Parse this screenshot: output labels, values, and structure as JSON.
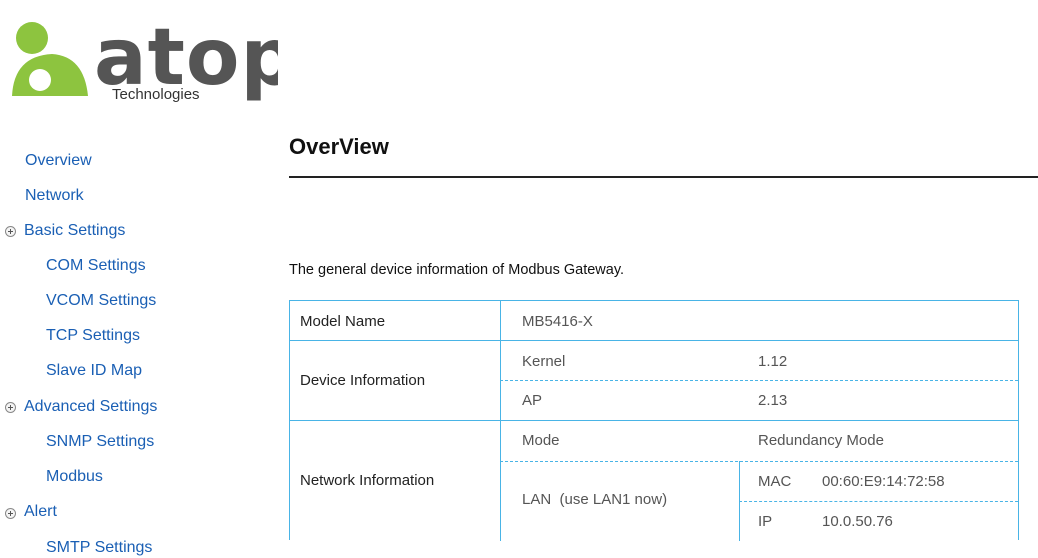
{
  "logo": {
    "wordmark": "atop",
    "tagline": "Technologies",
    "colors": {
      "green": "#8dc43f",
      "gray": "#555555"
    }
  },
  "sidebar": {
    "items": [
      {
        "label": "Overview"
      },
      {
        "label": "Network"
      },
      {
        "label": "Basic Settings",
        "group": true
      },
      {
        "label": "COM Settings"
      },
      {
        "label": "VCOM Settings"
      },
      {
        "label": "TCP Settings"
      },
      {
        "label": "Slave ID Map"
      },
      {
        "label": "Advanced Settings",
        "group": true
      },
      {
        "label": "SNMP Settings"
      },
      {
        "label": "Modbus"
      },
      {
        "label": "Alert",
        "group": true
      },
      {
        "label": "SMTP Settings"
      }
    ]
  },
  "main": {
    "title": "OverView",
    "intro": "The general device information of Modbus Gateway.",
    "table": {
      "model_label": "Model Name",
      "model_value": "MB5416-X",
      "device_label": "Device Information",
      "kernel_label": "Kernel",
      "kernel_value": "1.12",
      "ap_label": "AP",
      "ap_value": "2.13",
      "network_label": "Network Information",
      "mode_label": "Mode",
      "mode_value": "Redundancy Mode",
      "lan_label": "LAN  (use LAN1 now)",
      "mac_label": "MAC",
      "mac_value": "00:60:E9:14:72:58",
      "ip_label": "IP",
      "ip_value": "10.0.50.76"
    }
  },
  "colors": {
    "link": "#1a5fb4",
    "table_border": "#49b4e6"
  }
}
